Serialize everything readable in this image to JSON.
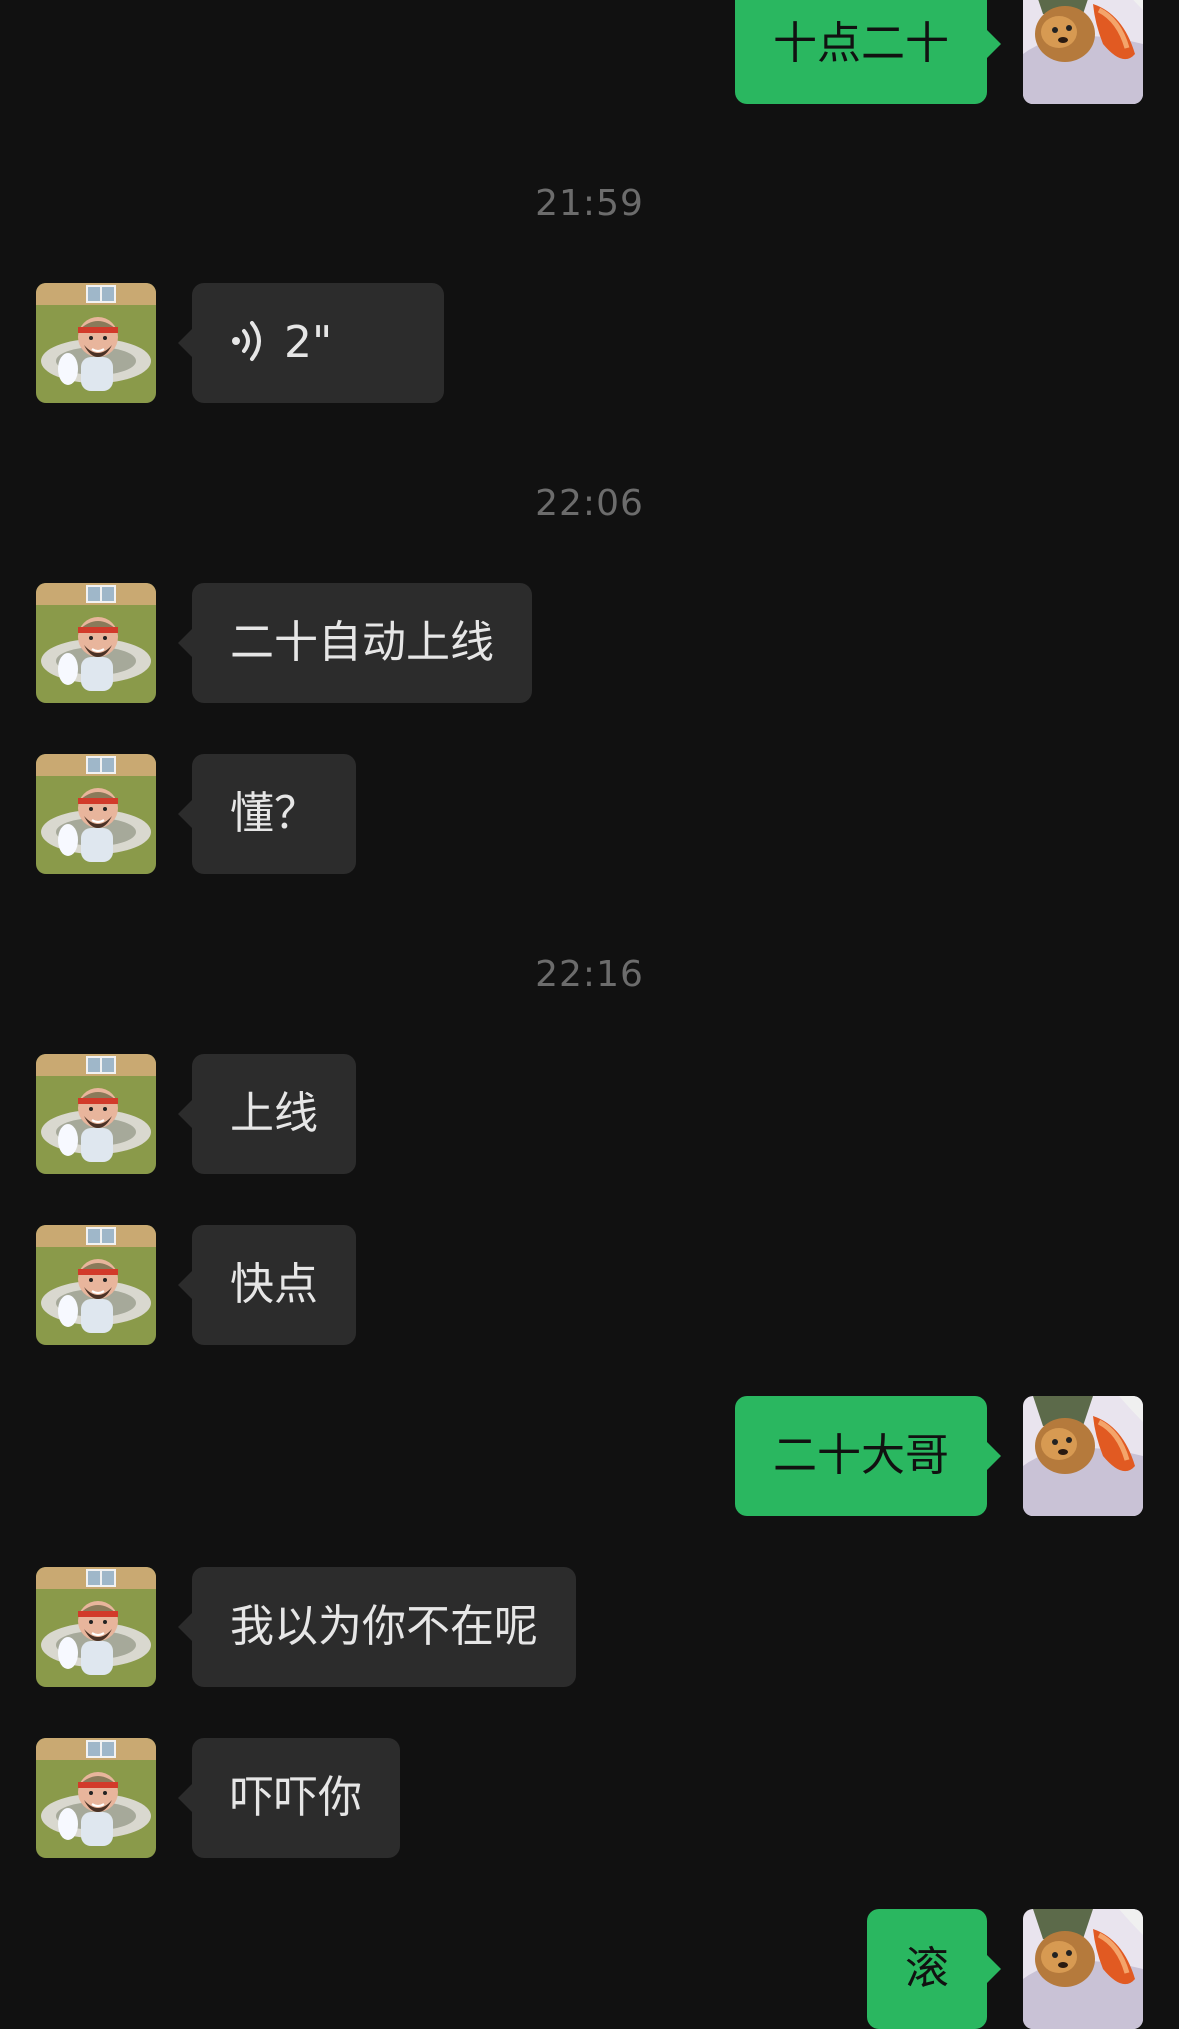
{
  "colors": {
    "background": "#111111",
    "incoming_bubble": "#2c2c2c",
    "outgoing_bubble": "#2ab760",
    "timestamp": "#6c6c6c"
  },
  "messages": [
    {
      "type": "out",
      "text": "十点二十"
    },
    {
      "type": "time",
      "text": "21:59"
    },
    {
      "type": "in_voice",
      "duration": "2\"",
      "icon": "voice-wave-icon"
    },
    {
      "type": "time",
      "text": "22:06"
    },
    {
      "type": "in",
      "text": "二十自动上线"
    },
    {
      "type": "in",
      "text": "懂？"
    },
    {
      "type": "time",
      "text": "22:16"
    },
    {
      "type": "in",
      "text": "上线"
    },
    {
      "type": "in",
      "text": "快点"
    },
    {
      "type": "out",
      "text": "二十大哥"
    },
    {
      "type": "in",
      "text": "我以为你不在呢"
    },
    {
      "type": "in",
      "text": "吓吓你"
    },
    {
      "type": "out",
      "text": "滚"
    }
  ]
}
